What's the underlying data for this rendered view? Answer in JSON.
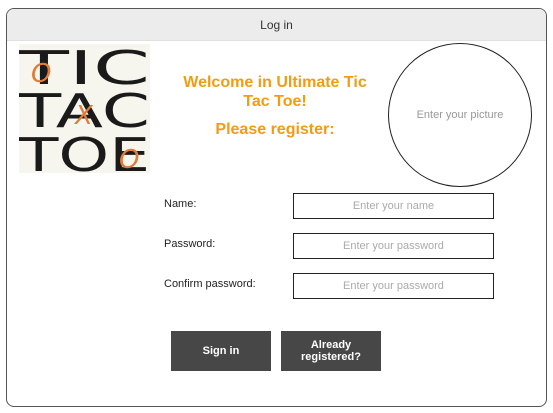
{
  "window": {
    "title": "Log in"
  },
  "logo": {
    "rows": [
      "TIC",
      "TAC",
      "TOE"
    ],
    "marks": [
      "O",
      "X",
      "O"
    ],
    "colors": {
      "text": "#1a1a1a",
      "accent": "#e07b39",
      "background": "#f6f6ee"
    }
  },
  "header": {
    "welcome": "Welcome in Ultimate Tic Tac Toe!",
    "prompt": "Please register:",
    "accent": "#f39c12"
  },
  "picture": {
    "placeholder": "Enter your picture"
  },
  "form": {
    "name_label": "Name:",
    "name_placeholder": "Enter your name",
    "name_value": "",
    "password_label": "Password:",
    "password_placeholder": "Enter your password",
    "password_value": "",
    "confirm_label": "Confirm password:",
    "confirm_placeholder": "Enter your password",
    "confirm_value": ""
  },
  "buttons": {
    "sign_in": "Sign in",
    "already_registered": "Already registered?",
    "color": "#474747"
  }
}
